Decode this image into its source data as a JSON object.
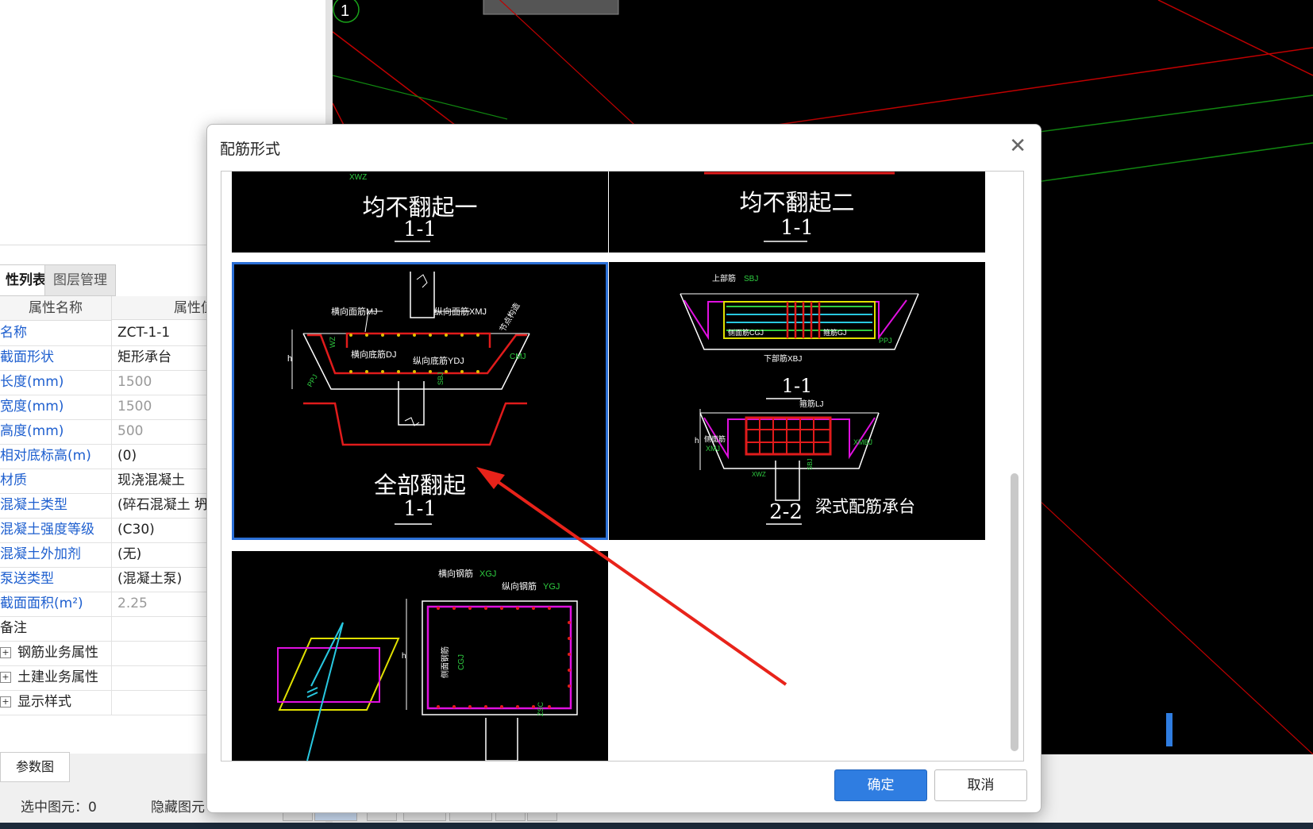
{
  "viewport": {
    "axis_label": "1"
  },
  "property_panel": {
    "tabs": [
      "性列表",
      "图层管理"
    ],
    "header": {
      "name_col": "属性名称",
      "value_col": "属性值"
    },
    "rows": [
      {
        "name": "名称",
        "value": "ZCT-1-1"
      },
      {
        "name": "截面形状",
        "value": "矩形承台"
      },
      {
        "name": "长度(mm)",
        "value": "1500"
      },
      {
        "name": "宽度(mm)",
        "value": "1500"
      },
      {
        "name": "高度(mm)",
        "value": "500"
      },
      {
        "name": "相对底标高(m)",
        "value": "(0)"
      },
      {
        "name": "材质",
        "value": "现浇混凝土"
      },
      {
        "name": "混凝土类型",
        "value": "(碎石混凝土 坍"
      },
      {
        "name": "混凝土强度等级",
        "value": "(C30)"
      },
      {
        "name": "混凝土外加剂",
        "value": "(无)"
      },
      {
        "name": "泵送类型",
        "value": "(混凝土泵)"
      },
      {
        "name": "截面面积(m²)",
        "value": "2.25"
      },
      {
        "name": "备注",
        "value": ""
      }
    ],
    "groups": [
      "钢筋业务属性",
      "土建业务属性",
      "显示样式"
    ],
    "param_button": "参数图"
  },
  "status_bar": {
    "selected": "选中图元：0",
    "hidden": "隐藏图元"
  },
  "dialog": {
    "title": "配筋形式",
    "ok": "确定",
    "cancel": "取消",
    "thumbs": [
      {
        "caption": "均不翻起一",
        "section": "1-1",
        "small": "XWZ"
      },
      {
        "caption": "均不翻起二",
        "section": "1-1"
      },
      {
        "caption": "全部翻起",
        "section": "1-1",
        "labels": [
          "横向面筋MJ",
          "纵向面筋XMJ",
          "横向底筋DJ",
          "纵向底筋YDJ",
          "CMJ",
          "节点构造",
          "WZ",
          "h",
          "PPJ",
          "SBJ"
        ]
      },
      {
        "caption": "梁式配筋承台",
        "section1": "1-1",
        "section2": "2-2",
        "labels": [
          "上部筋",
          "SBJ",
          "侧面筋CGJ",
          "箍筋GJ",
          "下部筋XBJ",
          "PPJ",
          "箍筋LJ",
          "侧面筋",
          "XMJ",
          "XMBJ",
          "XWZ",
          "SBJ",
          "h"
        ]
      },
      {
        "caption": "",
        "labels": [
          "横向钢筋",
          "XGJ",
          "纵向钢筋",
          "YGJ",
          "侧面钢筋",
          "CGJ",
          "h",
          "ZSC"
        ]
      }
    ]
  }
}
